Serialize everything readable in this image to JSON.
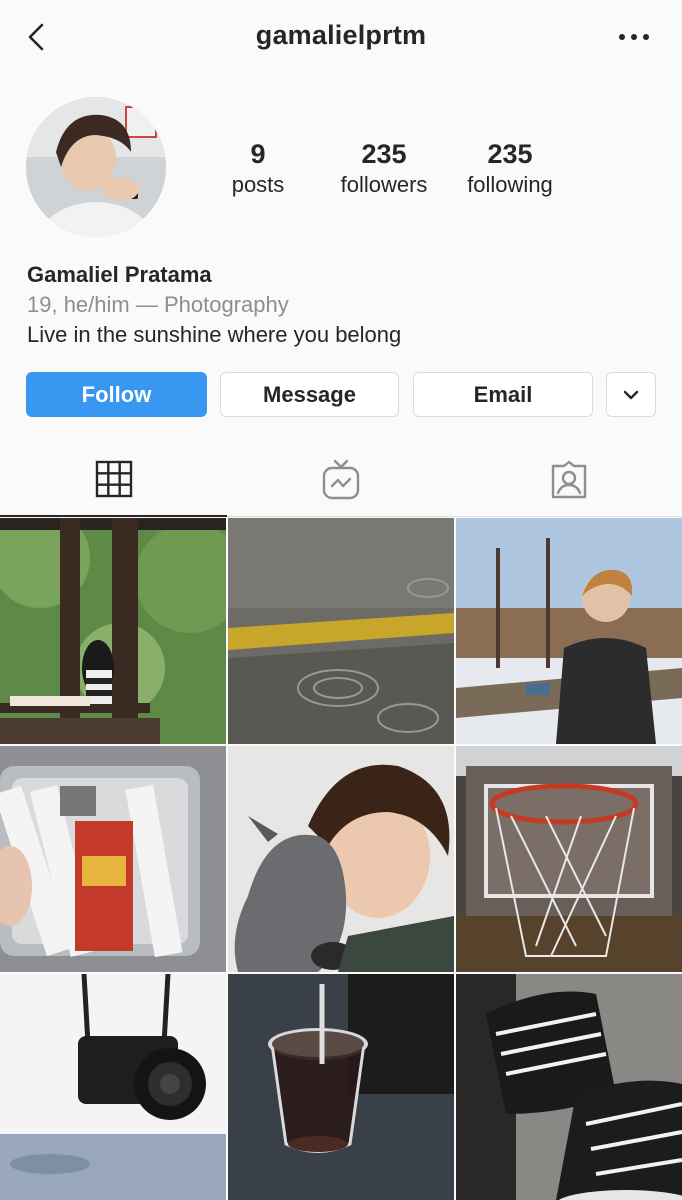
{
  "header": {
    "username": "gamalielprtm",
    "back_icon": "chevron-left-icon",
    "more_icon": "more-horizontal-icon"
  },
  "profile": {
    "stats": [
      {
        "value": "9",
        "label": "posts"
      },
      {
        "value": "235",
        "label": "followers"
      },
      {
        "value": "235",
        "label": "following"
      }
    ],
    "full_name": "Gamaliel Pratama",
    "category": "19, he/him — Photography",
    "bio": "Live in the sunshine where you belong"
  },
  "actions": {
    "follow": "Follow",
    "message": "Message",
    "email": "Email",
    "dropdown_icon": "chevron-down-icon"
  },
  "tabs": [
    {
      "icon": "grid-icon",
      "active": true
    },
    {
      "icon": "igtv-icon",
      "active": false
    },
    {
      "icon": "tagged-icon",
      "active": false
    }
  ],
  "colors": {
    "follow_button": "#3897f0",
    "text": "#262626",
    "secondary_text": "#8e8e8e",
    "border": "#dbdbdb",
    "background": "#fafafa"
  }
}
